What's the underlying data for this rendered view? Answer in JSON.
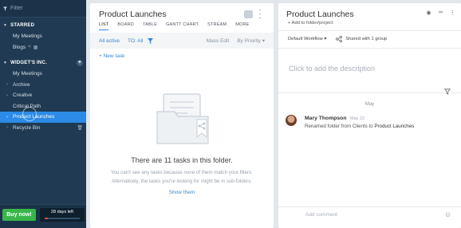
{
  "sidebar": {
    "filter_placeholder": "Filter",
    "starred_header": "STARRED",
    "starred_items": [
      {
        "label": "My Meetings"
      },
      {
        "label": "Blogs"
      }
    ],
    "account_header": "WIDGET'S INC.",
    "account_items": [
      {
        "label": "My Meetings"
      },
      {
        "label": "Archive"
      },
      {
        "label": "Creative"
      },
      {
        "label": "Critical Path"
      },
      {
        "label": "Product Launches"
      },
      {
        "label": "Recycle Bin"
      }
    ],
    "buy_label": "Buy now!",
    "days_left": "28 days left",
    "trial_progress": 0.1
  },
  "middle": {
    "title": "Product Launches",
    "tabs": [
      "LIST",
      "BOARD",
      "TABLE",
      "GANTT CHART",
      "STREAM",
      "MORE"
    ],
    "active_tab": "LIST",
    "toolbar": {
      "all_active": "All active",
      "to_all": "TO: All",
      "mass_edit": "Mass Edit",
      "sort": "By Priority ▾"
    },
    "new_task": "+ New task",
    "empty_title": "There are 11 tasks in this folder.",
    "empty_line1": "You can't see any tasks because none of them match your filters.",
    "empty_line2": "Alternatively, the tasks you're looking for might be in sub-folders.",
    "show_them": "Show them"
  },
  "right": {
    "title": "Product Launches",
    "add_to_folder": "+ Add to folder/project",
    "workflow": "Default Workflow",
    "shared": "Shared with 1 group",
    "description_placeholder": "Click to add the description",
    "date_divider": "May",
    "activity": {
      "author": "Mary Thompson",
      "time": "May 22",
      "text_prefix": "Renamed folder from Clients to ",
      "target": "Product Launches"
    },
    "comment_placeholder": "Add comment"
  },
  "colors": {
    "sidebar_bg": "#1f3a52",
    "selected": "#2b8be6",
    "link": "#3b86cf",
    "buy": "#39b54a"
  }
}
